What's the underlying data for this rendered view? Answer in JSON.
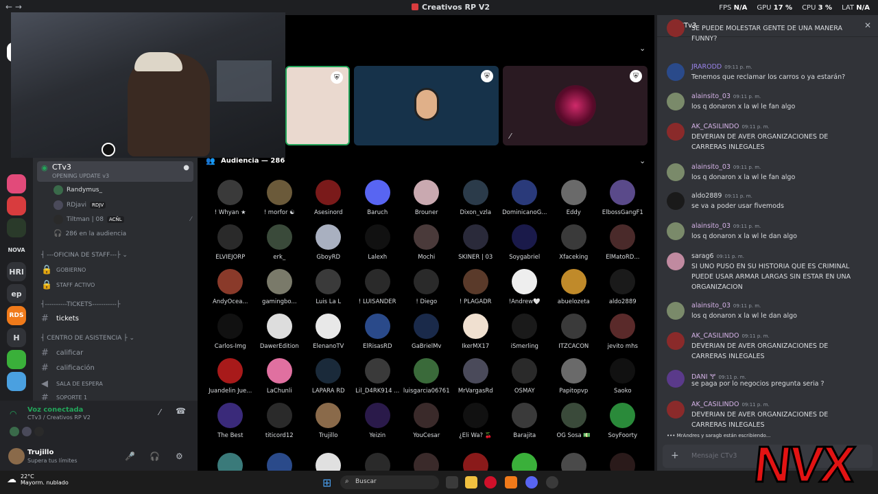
{
  "titlebar": {
    "title": "Creativos RP V2",
    "fps_label": "FPS",
    "fps": "N/A",
    "gpu_label": "GPU",
    "gpu": "17 %",
    "cpu_label": "CPU",
    "cpu": "3 %",
    "lat_label": "LAT",
    "lat": "N/A"
  },
  "guilds": [
    "NOVA",
    "HRl",
    "ep",
    "RDS",
    "H"
  ],
  "channels": {
    "voice_channel": {
      "name": "CTv3",
      "sub": "OPENING UPDATE v3"
    },
    "voice_users": [
      {
        "name": "Randymus_"
      },
      {
        "name": "RDjavi",
        "tag": "RDJV"
      },
      {
        "name": "Tiltman | 08",
        "tag": "ACÑL"
      }
    ],
    "audience_count": "286 en la audiencia",
    "cat_staff": "OFICINA DE STAFF",
    "staff_items": [
      "GOBIERNO",
      "STAFF ACTIVO"
    ],
    "cat_tickets": "TICKETS",
    "tickets": "tickets",
    "cat_asistencia": "CENTRO DE ASISTENCIA",
    "asistencia_items": [
      "calificar",
      "calificación",
      "SALA DE ESPERA",
      "SOPORTE 1"
    ]
  },
  "voice_panel": {
    "title": "Voz conectada",
    "sub": "CTv3 / Creativos RP V2"
  },
  "user": {
    "name": "Trujillo",
    "status": "Supera tus límites"
  },
  "stage": {
    "audience_title": "Audiencia — 286"
  },
  "audience": [
    {
      "name": "! Whyan ★",
      "color": "#3a3a3a"
    },
    {
      "name": "! morfor ☯",
      "color": "#6b5a3a"
    },
    {
      "name": "Asesinord",
      "color": "#7a1a1a"
    },
    {
      "name": "Baruch",
      "color": "#5865f2"
    },
    {
      "name": "Brouner",
      "color": "#c9a9b0"
    },
    {
      "name": "Dixon_vzla",
      "color": "#2b3b4a"
    },
    {
      "name": "DominicanoG...",
      "color": "#2a3a7a"
    },
    {
      "name": "Eddy",
      "color": "#6a6a6a"
    },
    {
      "name": "ElbossGangF1",
      "color": "#5a4a8a"
    },
    {
      "name": "ELVIEJORP",
      "color": "#2a2a2a"
    },
    {
      "name": "erk_",
      "color": "#3a4a3a"
    },
    {
      "name": "GboyRD",
      "color": "#a9b0c0"
    },
    {
      "name": "Lalexh",
      "color": "#111111"
    },
    {
      "name": "Mochi",
      "color": "#4a3a3a"
    },
    {
      "name": "SKINER | 03",
      "color": "#2a2a3a"
    },
    {
      "name": "Soygabriel",
      "color": "#1a1a4a"
    },
    {
      "name": "Xfaceking",
      "color": "#3a3a3a"
    },
    {
      "name": "ElMatoRD...",
      "color": "#4a2a2a"
    },
    {
      "name": "AndyOcea...",
      "color": "#8a3a2a"
    },
    {
      "name": "gamingbo...",
      "color": "#7a7a6a"
    },
    {
      "name": "Luis La L",
      "color": "#3a3a3a"
    },
    {
      "name": "! LUISANDER",
      "color": "#2a2a2a"
    },
    {
      "name": "! Diego",
      "color": "#2a2a2a"
    },
    {
      "name": "! PLAGADR",
      "color": "#5a3a2a"
    },
    {
      "name": "!Andrew🤍",
      "color": "#eeeeee"
    },
    {
      "name": "abuelozeta",
      "color": "#c08a2a"
    },
    {
      "name": "aldo2889",
      "color": "#1a1a1a"
    },
    {
      "name": "Carlos-Img",
      "color": "#111111"
    },
    {
      "name": "DawerEdition",
      "color": "#dddddd"
    },
    {
      "name": "ElenanoTV",
      "color": "#e8e8e8"
    },
    {
      "name": "ElRisasRD",
      "color": "#2a4a8a"
    },
    {
      "name": "GaBrielMv",
      "color": "#1a2a4a"
    },
    {
      "name": "IkerMX17",
      "color": "#f0e0d0"
    },
    {
      "name": "iSmerling",
      "color": "#1a1a1a"
    },
    {
      "name": "ITZCACON",
      "color": "#3a3a3a"
    },
    {
      "name": "jevito mhs",
      "color": "#5a2a2a"
    },
    {
      "name": "Juandelin Jue...",
      "color": "#a81a1a"
    },
    {
      "name": "LaChunli",
      "color": "#e070a0"
    },
    {
      "name": "LAPARA RD",
      "color": "#1a2a3a"
    },
    {
      "name": "Lil_D4RK914 ...",
      "color": "#3a3a3a"
    },
    {
      "name": "luisgarcia06761",
      "color": "#3a6a3a"
    },
    {
      "name": "MrVargasRd",
      "color": "#4a4a5a"
    },
    {
      "name": "OSMAY",
      "color": "#2a2a2a"
    },
    {
      "name": "Papitopvp",
      "color": "#6a6a6a"
    },
    {
      "name": "Saoko",
      "color": "#111111"
    },
    {
      "name": "The Best",
      "color": "#3a2a7a"
    },
    {
      "name": "titicord12",
      "color": "#2a2a2a"
    },
    {
      "name": "Trujillo",
      "color": "#8a6a4a"
    },
    {
      "name": "Yeizin",
      "color": "#2a1a4a"
    },
    {
      "name": "YouCesar",
      "color": "#3a2a2a"
    },
    {
      "name": "¿Eli Wa? 🍒",
      "color": "#111111"
    },
    {
      "name": "Barajita",
      "color": "#3a3a3a"
    },
    {
      "name": "OG Sosa 💵",
      "color": "#3a4a3a"
    },
    {
      "name": "SoyFoorty",
      "color": "#2a8a3a"
    }
  ],
  "chat": {
    "title": "CTv3",
    "messages": [
      {
        "author": "",
        "time": "",
        "text": "SE PUEDE MOLESTAR GENTE DE UNA MANERA FUNNY?",
        "color": "#dbdee1",
        "av": "#8a2a2a"
      },
      {
        "author": "JRARODD",
        "time": "09:11 p. m.",
        "text": "Tenemos que reclamar los carros o ya estarán?",
        "color": "#9b84ec",
        "av": "#2a4a8a"
      },
      {
        "author": "alainsito_03",
        "time": "09:11 p. m.",
        "text": "los q donaron x la wl le fan algo",
        "color": "#d6b3e8",
        "av": "#7a8a6a"
      },
      {
        "author": "AK_CASILINDO",
        "time": "09:11 p. m.",
        "text": "DEVERIAN DE AVER  ORGANIZACIONES  DE CARRERAS INLEGALES",
        "color": "#d6b3e8",
        "av": "#8a2a2a"
      },
      {
        "author": "alainsito_03",
        "time": "09:11 p. m.",
        "text": "los q donaron x la wl le fan algo",
        "color": "#d6b3e8",
        "av": "#7a8a6a"
      },
      {
        "author": "aldo2889",
        "time": "09:11 p. m.",
        "text": "se va a poder usar fivemods",
        "color": "#dbdee1",
        "av": "#1a1a1a"
      },
      {
        "author": "alainsito_03",
        "time": "09:11 p. m.",
        "text": "los q donaron x la wl le dan algo",
        "color": "#d6b3e8",
        "av": "#7a8a6a"
      },
      {
        "author": "sarag6",
        "time": "09:11 p. m.",
        "text": "SI UNO PUSO EN SU HISTORIA QUE ES CRIMINAL PUEDE USAR ARMAR LARGAS SIN ESTAR EN UNA ORGANIZACION",
        "color": "#dbdee1",
        "av": "#c08aa0"
      },
      {
        "author": "alainsito_03",
        "time": "09:11 p. m.",
        "text": "los q donaron x la wl le dan algo",
        "color": "#d6b3e8",
        "av": "#7a8a6a"
      },
      {
        "author": "AK_CASILINDO",
        "time": "09:11 p. m.",
        "text": "DEVERIAN DE AVER  ORGANIZACIONES  DE CARRERAS INLEGALES",
        "color": "#d6b3e8",
        "av": "#8a2a2a"
      },
      {
        "author": "DANI 🝖",
        "time": "09:11 p. m.",
        "text": "se paga por lo negocios pregunta seria ?",
        "color": "#d6b3e8",
        "av": "#5a3a8a"
      },
      {
        "author": "AK_CASILINDO",
        "time": "09:11 p. m.",
        "text": "DEVERIAN DE AVER  ORGANIZACIONES  DE CARRERAS INLEGALES",
        "color": "#d6b3e8",
        "av": "#8a2a2a"
      }
    ],
    "typing": "MrAndres y saragb están escribiendo...",
    "input_placeholder": "Mensaje CTv3"
  },
  "taskbar": {
    "temp": "22°C",
    "weather": "Mayorm. nublado",
    "search": "Buscar"
  },
  "watermark": "NVX"
}
